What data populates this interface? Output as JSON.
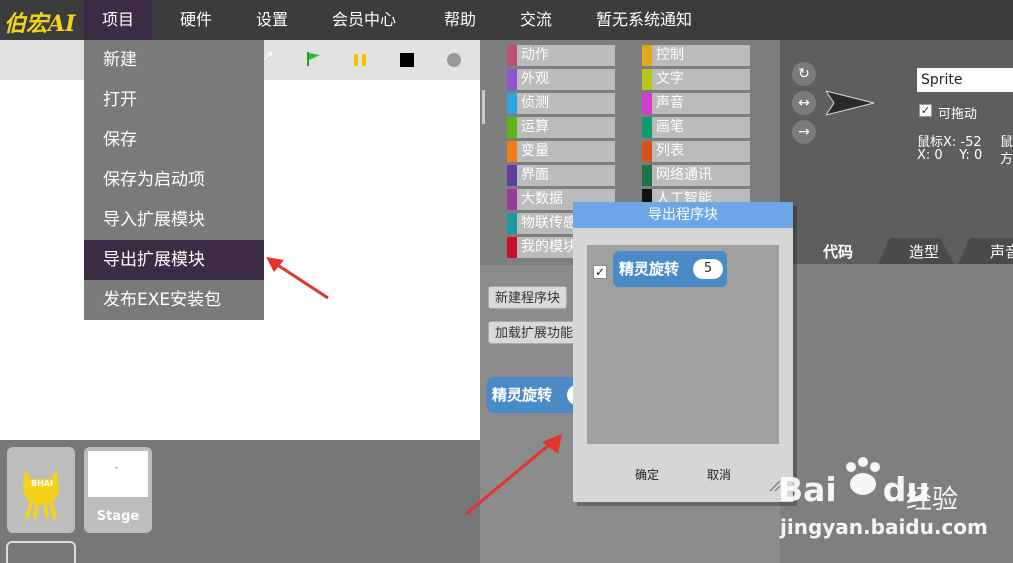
{
  "app": {
    "logo": "伯宏AI"
  },
  "menubar": {
    "items": [
      "项目",
      "硬件",
      "设置",
      "会员中心",
      "帮助",
      "交流",
      "暂无系统通知"
    ]
  },
  "project_menu": {
    "items": [
      "新建",
      "打开",
      "保存",
      "保存为启动项",
      "导入扩展模块",
      "导出扩展模块",
      "发布EXE安装包"
    ],
    "highlighted": "导出扩展模块"
  },
  "stage_toolbar": {
    "icons": [
      "fullscreen-icon",
      "green-flag-icon",
      "pause-icon",
      "stop-icon",
      "record-icon"
    ]
  },
  "sprites": {
    "sprite_label": "BHAI",
    "stage_label": "Stage",
    "stage_dot": "-"
  },
  "palette": {
    "left": [
      {
        "label": "动作",
        "color": "#c05070"
      },
      {
        "label": "外观",
        "color": "#8a55d7"
      },
      {
        "label": "侦测",
        "color": "#2ca5e2"
      },
      {
        "label": "运算",
        "color": "#5cb712"
      },
      {
        "label": "变量",
        "color": "#ee7d16"
      },
      {
        "label": "界面",
        "color": "#5b3ea0"
      },
      {
        "label": "大数据",
        "color": "#9a3a9a"
      },
      {
        "label": "物联传感",
        "color": "#1b9aa0"
      },
      {
        "label": "我的模块",
        "color": "#c8102e"
      }
    ],
    "right": [
      {
        "label": "控制",
        "color": "#e1a91a"
      },
      {
        "label": "文字",
        "color": "#b8c51a"
      },
      {
        "label": "声音",
        "color": "#cf3dcf"
      },
      {
        "label": "画笔",
        "color": "#0e9a6c"
      },
      {
        "label": "列表",
        "color": "#d9531e"
      },
      {
        "label": "网络通讯",
        "color": "#217346"
      },
      {
        "label": "人工智能",
        "color": "#111111"
      }
    ]
  },
  "procedure_buttons": {
    "new": "新建程序块",
    "load": "加载扩展功能"
  },
  "script_block": {
    "label": "精灵旋转"
  },
  "sprite_info": {
    "name": "Sprite",
    "draggable_label": "可拖动",
    "mouse_x": "鼠标X: -52",
    "mouse_y_partial": "鼠",
    "pos": "X: 0    Y: 0",
    "dir_partial": "方"
  },
  "rotation_buttons": [
    "↻",
    "↔",
    "→"
  ],
  "tabs": [
    "代码",
    "造型",
    "声音"
  ],
  "dialog": {
    "title": "导出程序块",
    "block_label": "精灵旋转",
    "block_value": "5",
    "checked": true,
    "ok": "确定",
    "cancel": "取消"
  },
  "watermark": {
    "brand": "Bai",
    "brand2": "du",
    "suffix": "经验",
    "url": "jingyan.baidu.com"
  }
}
